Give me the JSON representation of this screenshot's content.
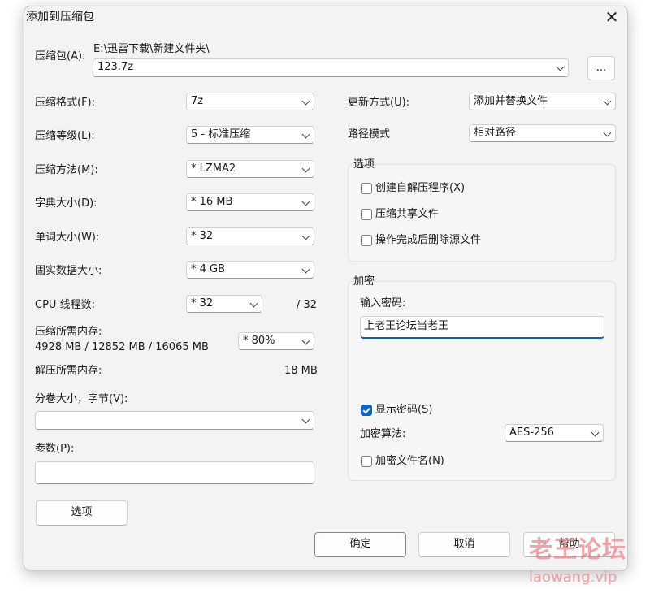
{
  "window": {
    "title": "添加到压缩包",
    "close_symbol": "✕"
  },
  "archive": {
    "label": "压缩包(A):",
    "path": "E:\\迅雷下载\\新建文件夹\\",
    "filename": "123.7z",
    "browse_label": "..."
  },
  "left": {
    "format_label": "压缩格式(F):",
    "format_value": "7z",
    "level_label": "压缩等级(L):",
    "level_value": "5 - 标准压缩",
    "method_label": "压缩方法(M):",
    "method_value": "*  LZMA2",
    "dict_label": "字典大小(D):",
    "dict_value": "*  16 MB",
    "word_label": "单词大小(W):",
    "word_value": "*  32",
    "solid_label": "固实数据大小:",
    "solid_value": "*  4 GB",
    "cpu_label": "CPU 线程数:",
    "cpu_value": "*  32",
    "cpu_max": "/ 32",
    "mem_comp_label": "压缩所需内存:",
    "mem_comp_detail": "4928 MB / 12852 MB / 16065 MB",
    "mem_comp_value": "*  80%",
    "mem_decomp_label": "解压所需内存:",
    "mem_decomp_value": "18 MB",
    "split_label": "分卷大小，字节(V):",
    "split_value": "",
    "params_label": "参数(P):",
    "params_value": "",
    "options_button": "选项"
  },
  "right": {
    "update_label": "更新方式(U):",
    "update_value": "添加并替换文件",
    "pathmode_label": "路径模式",
    "pathmode_value": "相对路径",
    "options_group": {
      "title": "选项",
      "sfx": {
        "label": "创建自解压程序(X)",
        "checked": false
      },
      "shared": {
        "label": "压缩共享文件",
        "checked": false
      },
      "delete": {
        "label": "操作完成后删除源文件",
        "checked": false
      }
    },
    "encryption_group": {
      "title": "加密",
      "password_label": "输入密码:",
      "password_value": "上老王论坛当老王",
      "show_password": {
        "label": "显示密码(S)",
        "checked": true
      },
      "method_label": "加密算法:",
      "method_value": "AES-256",
      "encrypt_names": {
        "label": "加密文件名(N)",
        "checked": false
      }
    }
  },
  "buttons": {
    "ok": "确定",
    "cancel": "取消",
    "help": "帮助"
  },
  "watermark": {
    "line1": "老王论坛",
    "line2": "laowang.vip"
  }
}
